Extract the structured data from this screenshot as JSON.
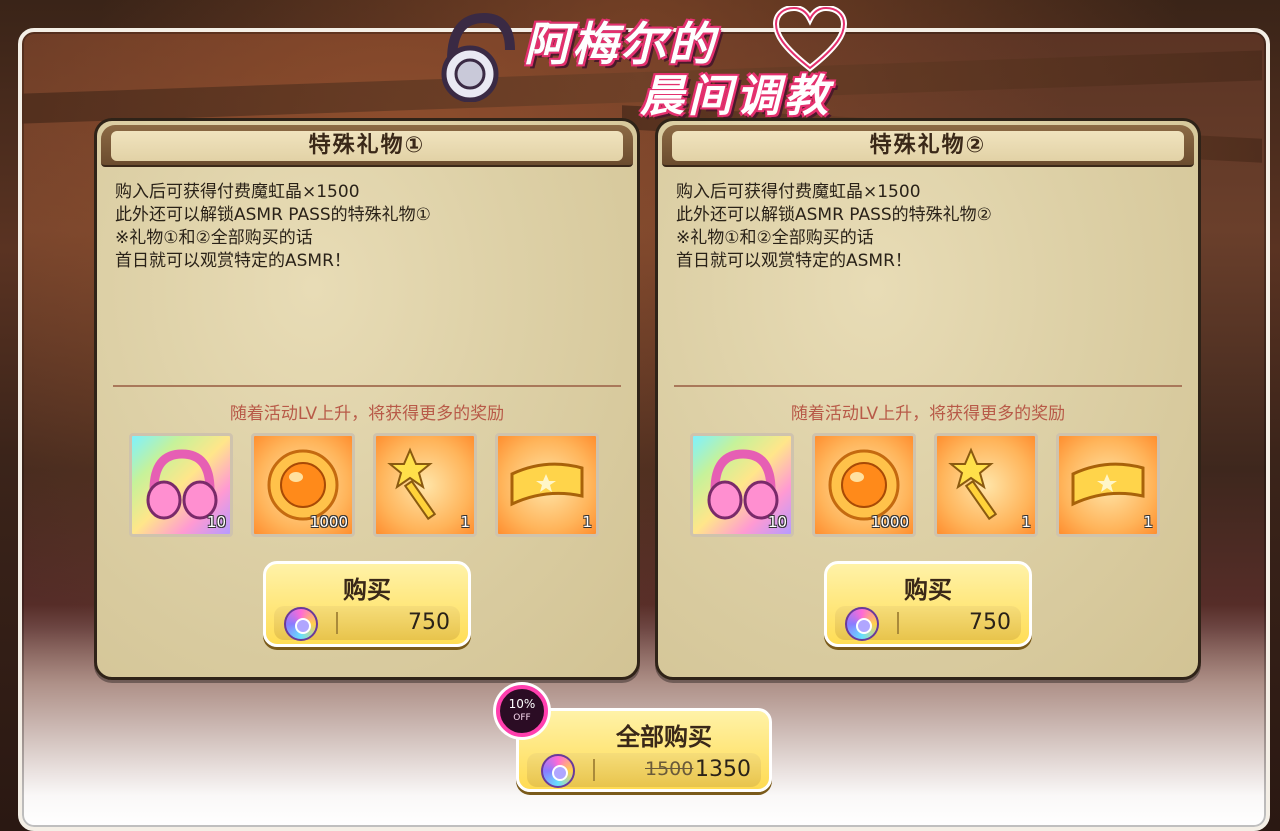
{
  "title": {
    "line1": "阿梅尔的",
    "line2": "晨间调教"
  },
  "panels": [
    {
      "header": "特殊礼物①",
      "description": [
        "购入后可获得付费魔虹晶×1500",
        "此外还可以解锁ASMR PASS的特殊礼物①",
        "※礼物①和②全部购买的话",
        "首日就可以观赏特定的ASMR！"
      ],
      "note": "随着活动LV上升，将获得更多的奖励",
      "items": [
        {
          "icon": "headphones-icon",
          "count": "10"
        },
        {
          "icon": "sun-orb-icon",
          "count": "1000"
        },
        {
          "icon": "star-key-icon",
          "count": "1"
        },
        {
          "icon": "ticket-icon",
          "count": "1"
        }
      ],
      "buy_label": "购买",
      "price": "750"
    },
    {
      "header": "特殊礼物②",
      "description": [
        "购入后可获得付费魔虹晶×1500",
        "此外还可以解锁ASMR PASS的特殊礼物②",
        "※礼物①和②全部购买的话",
        "首日就可以观赏特定的ASMR！"
      ],
      "note": "随着活动LV上升，将获得更多的奖励",
      "items": [
        {
          "icon": "headphones-icon",
          "count": "10"
        },
        {
          "icon": "sun-orb-icon",
          "count": "1000"
        },
        {
          "icon": "star-key-icon",
          "count": "1"
        },
        {
          "icon": "ticket-icon",
          "count": "1"
        }
      ],
      "buy_label": "购买",
      "price": "750"
    }
  ],
  "buy_all": {
    "label": "全部购买",
    "discount": "10%",
    "off": "OFF",
    "original_price": "1500",
    "price": "1350"
  }
}
